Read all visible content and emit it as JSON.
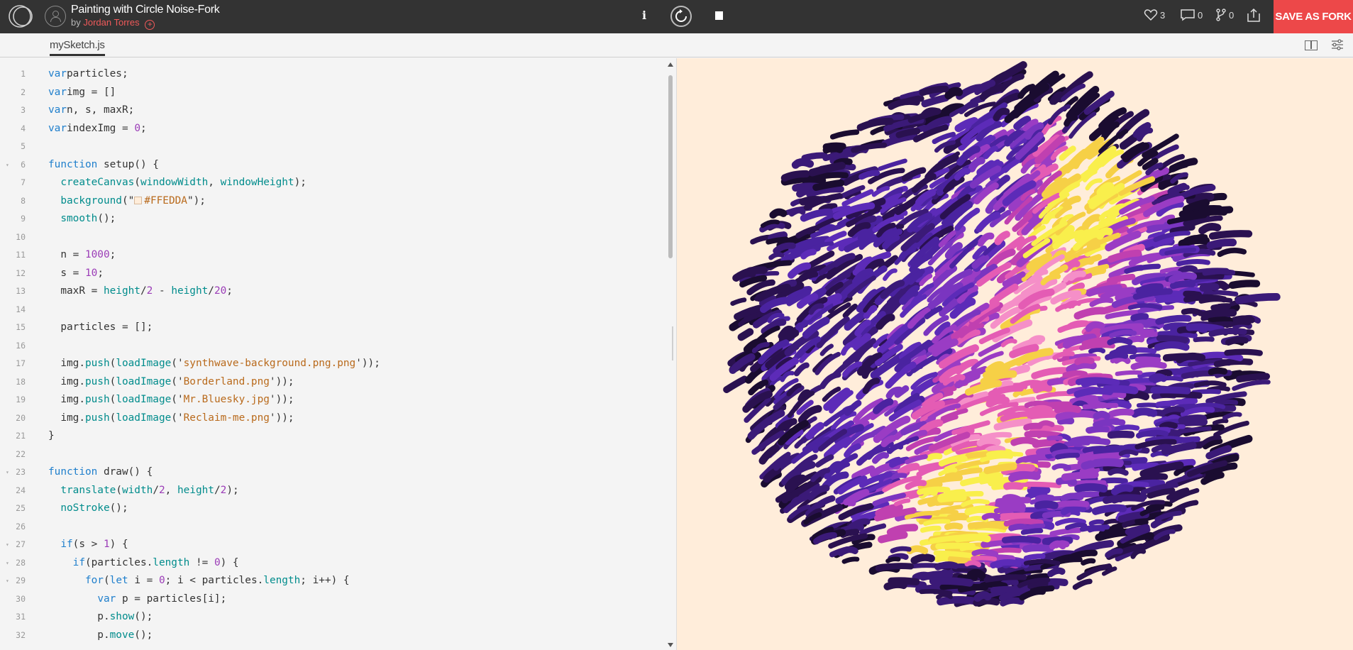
{
  "header": {
    "sketch_title": "Painting with Circle Noise-Fork",
    "by_label": "by",
    "author": "Jordan Torres",
    "follow_symbol": "+",
    "info_label": "i",
    "likes": "3",
    "comments": "0",
    "forks": "0",
    "save_button": "SAVE AS FORK",
    "accent_color": "#ed4849"
  },
  "tabs": [
    {
      "label": "mySketch.js",
      "active": true
    }
  ],
  "editor": {
    "lines": [
      [
        [
          "k",
          "var"
        ],
        [
          "",
          "particles;"
        ]
      ],
      [
        [
          "k",
          "var"
        ],
        [
          "",
          "img = []"
        ]
      ],
      [
        [
          "k",
          "var"
        ],
        [
          "",
          "n, s, maxR;"
        ]
      ],
      [
        [
          "k",
          "var"
        ],
        [
          "",
          "indexImg = "
        ],
        [
          "n",
          "0"
        ],
        [
          "",
          ";"
        ]
      ],
      [],
      [
        [
          "k",
          "function"
        ],
        [
          "",
          " setup() {"
        ]
      ],
      [
        [
          "",
          "  "
        ],
        [
          "f",
          "createCanvas"
        ],
        [
          "",
          "("
        ],
        [
          "f",
          "windowWidth"
        ],
        [
          "",
          ", "
        ],
        [
          "f",
          "windowHeight"
        ],
        [
          "",
          ");"
        ]
      ],
      [
        [
          "",
          "  "
        ],
        [
          "f",
          "background"
        ],
        [
          "",
          "(\""
        ],
        [
          "swatch",
          ""
        ],
        [
          "s",
          "#FFEDDA"
        ],
        [
          "",
          "\");"
        ]
      ],
      [
        [
          "",
          "  "
        ],
        [
          "f",
          "smooth"
        ],
        [
          "",
          "();"
        ]
      ],
      [],
      [
        [
          "",
          "  n = "
        ],
        [
          "n",
          "1000"
        ],
        [
          "",
          ";"
        ]
      ],
      [
        [
          "",
          "  s = "
        ],
        [
          "n",
          "10"
        ],
        [
          "",
          ";"
        ]
      ],
      [
        [
          "",
          "  maxR = "
        ],
        [
          "f",
          "height"
        ],
        [
          "",
          "/"
        ],
        [
          "n",
          "2"
        ],
        [
          "",
          " - "
        ],
        [
          "f",
          "height"
        ],
        [
          "",
          "/"
        ],
        [
          "n",
          "20"
        ],
        [
          "",
          ";"
        ]
      ],
      [],
      [
        [
          "",
          "  particles = [];"
        ]
      ],
      [],
      [
        [
          "",
          "  img."
        ],
        [
          "f",
          "push"
        ],
        [
          "",
          "("
        ],
        [
          "f",
          "loadImage"
        ],
        [
          "",
          "('"
        ],
        [
          "s",
          "synthwave-background.png.png"
        ],
        [
          "",
          "'));"
        ]
      ],
      [
        [
          "",
          "  img."
        ],
        [
          "f",
          "push"
        ],
        [
          "",
          "("
        ],
        [
          "f",
          "loadImage"
        ],
        [
          "",
          "('"
        ],
        [
          "s",
          "Borderland.png"
        ],
        [
          "",
          "'));"
        ]
      ],
      [
        [
          "",
          "  img."
        ],
        [
          "f",
          "push"
        ],
        [
          "",
          "("
        ],
        [
          "f",
          "loadImage"
        ],
        [
          "",
          "('"
        ],
        [
          "s",
          "Mr.Bluesky.jpg"
        ],
        [
          "",
          "'));"
        ]
      ],
      [
        [
          "",
          "  img."
        ],
        [
          "f",
          "push"
        ],
        [
          "",
          "("
        ],
        [
          "f",
          "loadImage"
        ],
        [
          "",
          "('"
        ],
        [
          "s",
          "Reclaim-me.png"
        ],
        [
          "",
          "'));"
        ]
      ],
      [
        [
          "",
          "}"
        ]
      ],
      [],
      [
        [
          "k",
          "function"
        ],
        [
          "",
          " draw() {"
        ]
      ],
      [
        [
          "",
          "  "
        ],
        [
          "f",
          "translate"
        ],
        [
          "",
          "("
        ],
        [
          "f",
          "width"
        ],
        [
          "",
          "/"
        ],
        [
          "n",
          "2"
        ],
        [
          "",
          ", "
        ],
        [
          "f",
          "height"
        ],
        [
          "",
          "/"
        ],
        [
          "n",
          "2"
        ],
        [
          "",
          ");"
        ]
      ],
      [
        [
          "",
          "  "
        ],
        [
          "f",
          "noStroke"
        ],
        [
          "",
          "();"
        ]
      ],
      [],
      [
        [
          "",
          "  "
        ],
        [
          "k",
          "if"
        ],
        [
          "",
          "(s > "
        ],
        [
          "n",
          "1"
        ],
        [
          "",
          ") {"
        ]
      ],
      [
        [
          "",
          "    "
        ],
        [
          "k",
          "if"
        ],
        [
          "",
          "(particles."
        ],
        [
          "f",
          "length"
        ],
        [
          "",
          " != "
        ],
        [
          "n",
          "0"
        ],
        [
          "",
          ") {"
        ]
      ],
      [
        [
          "",
          "      "
        ],
        [
          "k",
          "for"
        ],
        [
          "",
          "("
        ],
        [
          "k",
          "let"
        ],
        [
          "",
          " i = "
        ],
        [
          "n",
          "0"
        ],
        [
          "",
          "; i < particles."
        ],
        [
          "f",
          "length"
        ],
        [
          "",
          "; i++) {"
        ]
      ],
      [
        [
          "",
          "        "
        ],
        [
          "k",
          "var"
        ],
        [
          "",
          " p = particles[i];"
        ]
      ],
      [
        [
          "",
          "        p."
        ],
        [
          "f",
          "show"
        ],
        [
          "",
          "();"
        ]
      ],
      [
        [
          "",
          "        p."
        ],
        [
          "f",
          "move"
        ],
        [
          "",
          "();"
        ]
      ]
    ],
    "folded_lines": [
      6,
      23,
      27,
      28,
      29
    ]
  },
  "preview": {
    "background_color": "#ffedda",
    "palette": [
      "#1a0c30",
      "#2a1150",
      "#3b1a78",
      "#4a23a0",
      "#5c2bb8",
      "#7a35c0",
      "#9a3cc4",
      "#c040b0",
      "#e45cb4",
      "#f58fc8",
      "#f6d046",
      "#f9ef4c",
      "#ffffff"
    ]
  }
}
